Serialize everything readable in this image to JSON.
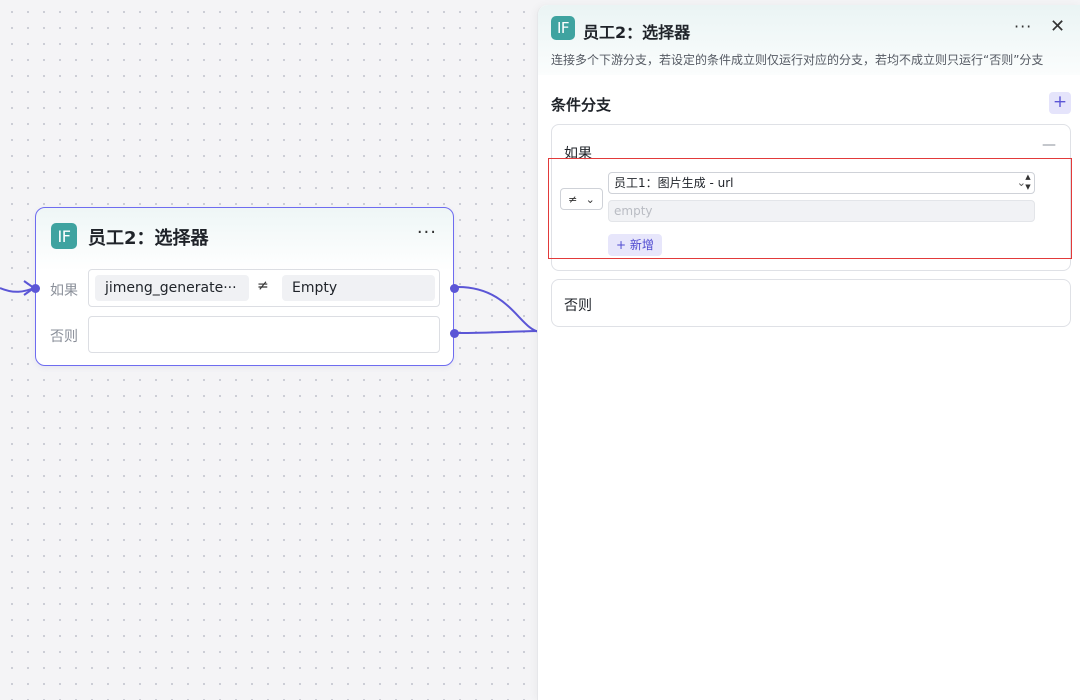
{
  "node": {
    "badge": "IF",
    "title": "员工2：选择器",
    "more": "···",
    "if_label": "如果",
    "else_label": "否则",
    "condition_variable": "jimeng_generate···",
    "condition_operator": "≠",
    "condition_value": "Empty"
  },
  "panel": {
    "badge": "IF",
    "title": "员工2：选择器",
    "more": "···",
    "close": "✕",
    "description": "连接多个下游分支，若设定的条件成立则仅运行对应的分支，若均不成立则只运行“否则”分支",
    "section_title": "条件分支",
    "add_branch": "+",
    "if_branch": {
      "label": "如果",
      "collapse": "—",
      "operator": "≠",
      "operator_caret": "⌄",
      "variable": "员工1：图片生成 - url",
      "variable_caret": "⌄",
      "value_placeholder": "empty",
      "add_condition": "+ 新增"
    },
    "else_branch": {
      "label": "否则"
    }
  },
  "colors": {
    "accent": "#5b56d6",
    "badge": "#3fa3a0",
    "highlight": "#e23a3a"
  }
}
